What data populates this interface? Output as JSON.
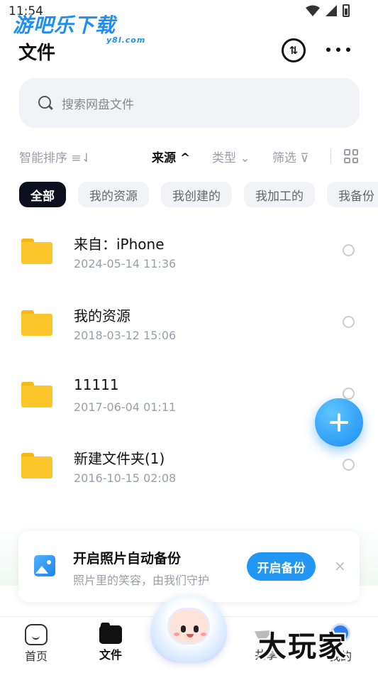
{
  "status": {
    "time": "11:54"
  },
  "watermark_top": {
    "main": "游吧乐下载",
    "sub": "y8l.com"
  },
  "header": {
    "title": "文件",
    "transfer_symbol": "⇅"
  },
  "search": {
    "placeholder": "搜索网盘文件"
  },
  "sort_bar": {
    "smart_sort": "智能排序 ≡⇃",
    "source": "来源 ^",
    "type": "类型 ⌄",
    "filter": "筛选 ⊽"
  },
  "chips": [
    "全部",
    "我的资源",
    "我创建的",
    "我加工的",
    "我备份"
  ],
  "files": [
    {
      "name": "来自：iPhone",
      "date": "2024-05-14  11:36"
    },
    {
      "name": "我的资源",
      "date": "2018-03-12  15:06"
    },
    {
      "name": "11111",
      "date": "2017-06-04  01:11"
    },
    {
      "name": "新建文件夹(1)",
      "date": "2016-10-15  02:08"
    }
  ],
  "banner": {
    "title": "开启照片自动备份",
    "subtitle": "照片里的笑容，由我们守护",
    "button": "开启备份",
    "close": "×"
  },
  "bottom_nav": {
    "home": "首页",
    "files": "文件",
    "share": "共享",
    "me": "我的"
  },
  "watermark_bottom": "大玩家",
  "colors": {
    "accent": "#2196f3",
    "chip_active_bg": "#0b0f1e",
    "folder": "#fcc62b",
    "muted_text": "#9a9ea8"
  }
}
